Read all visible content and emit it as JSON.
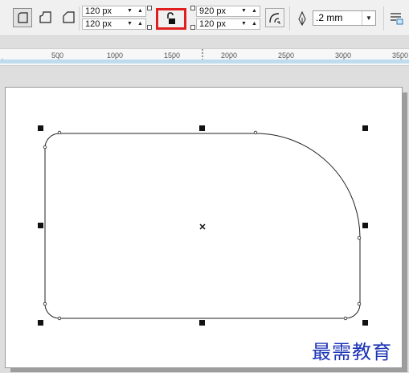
{
  "toolbar": {
    "corner_tools": [
      {
        "name": "round-corner",
        "active": true
      },
      {
        "name": "scalloped-corner",
        "active": false
      },
      {
        "name": "chamfered-corner",
        "active": false
      }
    ],
    "corner_radius": {
      "top_left": "120 px",
      "bottom_left": "120 px",
      "top_right": "920 px",
      "bottom_right": "120 px"
    },
    "lock_icon": "unlocked-padlock-icon",
    "outline_width": ".2 mm"
  },
  "ruler": {
    "labels": [
      "500",
      "1000",
      "1500",
      "2000",
      "2500",
      "3000",
      "3500"
    ]
  },
  "watermark": "最需教育",
  "colors": {
    "lock_highlight": "#e02020",
    "watermark": "#1c34b6",
    "ruler_band": "#bfdcef"
  }
}
